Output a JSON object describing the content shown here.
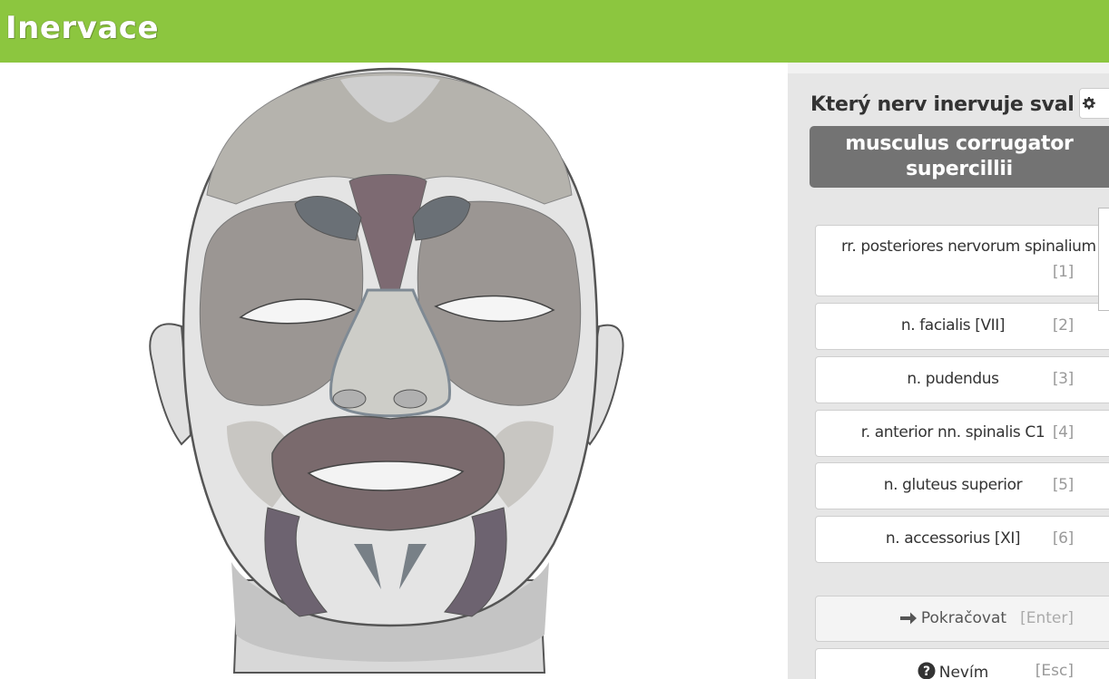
{
  "header": {
    "logo_text": "Inervace",
    "background_color": "#8cc63f"
  },
  "illustration": {
    "subject": "face-muscles-frontal-view"
  },
  "quiz": {
    "question": "Který nerv inervuje sval",
    "muscle": "musculus corrugator supercillii",
    "settings_icon": "gear-icon",
    "options": [
      {
        "label": "rr. posteriores nervorum spinalium",
        "key": "[1]"
      },
      {
        "label": "n. facialis [VII]",
        "key": "[2]"
      },
      {
        "label": "n. pudendus",
        "key": "[3]"
      },
      {
        "label": "r. anterior nn. spinalis C1",
        "key": "[4]"
      },
      {
        "label": "n. gluteus superior",
        "key": "[5]"
      },
      {
        "label": "n. accessorius [XI]",
        "key": "[6]"
      }
    ],
    "continue": {
      "label": "Pokračovat",
      "key": "[Enter]",
      "icon": "arrow-right-icon"
    },
    "dont_know": {
      "label": "Nevím",
      "key": "[Esc]",
      "icon": "question-circle-icon"
    }
  }
}
